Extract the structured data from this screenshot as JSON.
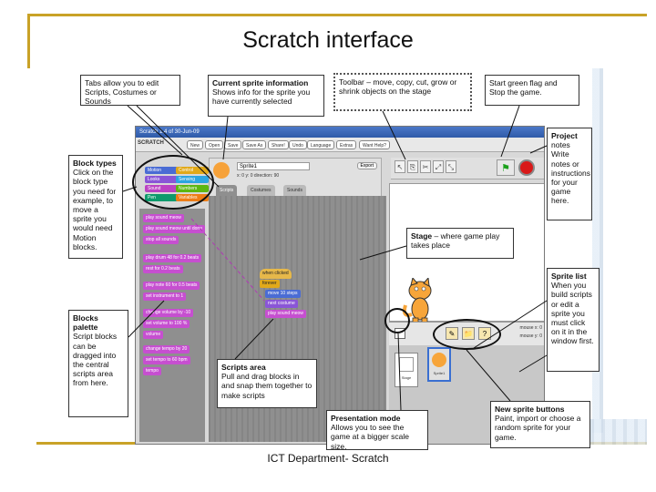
{
  "slide": {
    "title": "Scratch interface",
    "footer": "ICT Department- Scratch"
  },
  "callouts": {
    "tabs": "Tabs allow you to edit Scripts, Costumes or Sounds",
    "current_sprite_title": "Current sprite information",
    "current_sprite_body": "Shows info for the sprite you have currently selected",
    "toolbar": "Toolbar – move, copy, cut, grow or shrink objects on the stage",
    "start": "Start green flag and Stop the game.",
    "project_notes_title": "Project",
    "project_notes_body": "notes Write notes or instructions for your game here.",
    "block_types_title": "Block types",
    "block_types_body": "Click on the block type you need for example, to move a sprite you would need Motion blocks.",
    "stage_title": "Stage",
    "stage_body": " – where game play takes place",
    "sprite_list_title": "Sprite list",
    "sprite_list_body": "When you build scripts or edit a sprite you must click on it in the window first.",
    "blocks_palette_title": "Blocks palette",
    "blocks_palette_body": "Script blocks can be dragged into the central scripts area from here.",
    "scripts_area_title": "Scripts area",
    "scripts_area_body": "Pull and drag blocks in and snap them together to make scripts",
    "presentation_title": "Presentation mode",
    "presentation_body": "Allows you to see the game at a bigger scale size.",
    "new_sprite_title": "New sprite buttons",
    "new_sprite_body": "Paint, import or choose a random sprite for your game."
  },
  "scratch": {
    "window_title": "Scratch 1.4 of 30-Jun-09",
    "logo": "SCRATCH",
    "menu": [
      "New",
      "Open",
      "Save",
      "Save As",
      "Share!",
      "Undo",
      "Language",
      "Extras",
      "Want Help?"
    ],
    "categories_left": [
      "Motion",
      "Looks",
      "Sound",
      "Pen"
    ],
    "categories_right": [
      "Control",
      "Sensing",
      "Numbers",
      "Variables"
    ],
    "cat_colors": [
      "#4a6cd4",
      "#8a55d7",
      "#bb42c3",
      "#0e9a6c",
      "#e1a91a",
      "#2ca5e2",
      "#5cb712",
      "#ee7d16"
    ],
    "sprite_name": "Sprite1",
    "sprite_info": "x: 0  y: 0  direction: 90",
    "export": "Export",
    "tabs": [
      "Scripts",
      "Costumes",
      "Sounds"
    ],
    "palette_blocks": [
      "play sound  meow",
      "play sound  meow  until done",
      "stop all sounds",
      "play drum  48  for  0.2  beats",
      "rest for  0.2  beats",
      "play note  60  for  0.5  beats",
      "set instrument to  1",
      "change volume by  -10",
      "set volume to  100  %",
      "volume",
      "change tempo by  20",
      "set tempo to  60  bpm",
      "tempo"
    ],
    "script_hat": "when clicked",
    "script_blocks": [
      "forever",
      "move  10  steps",
      "next costume",
      "play sound  meow"
    ],
    "sprite_list_label": "Sprite1",
    "stage_label": "Stage",
    "mouse_x": "mouse x: 0",
    "mouse_y": "mouse y: 0"
  }
}
